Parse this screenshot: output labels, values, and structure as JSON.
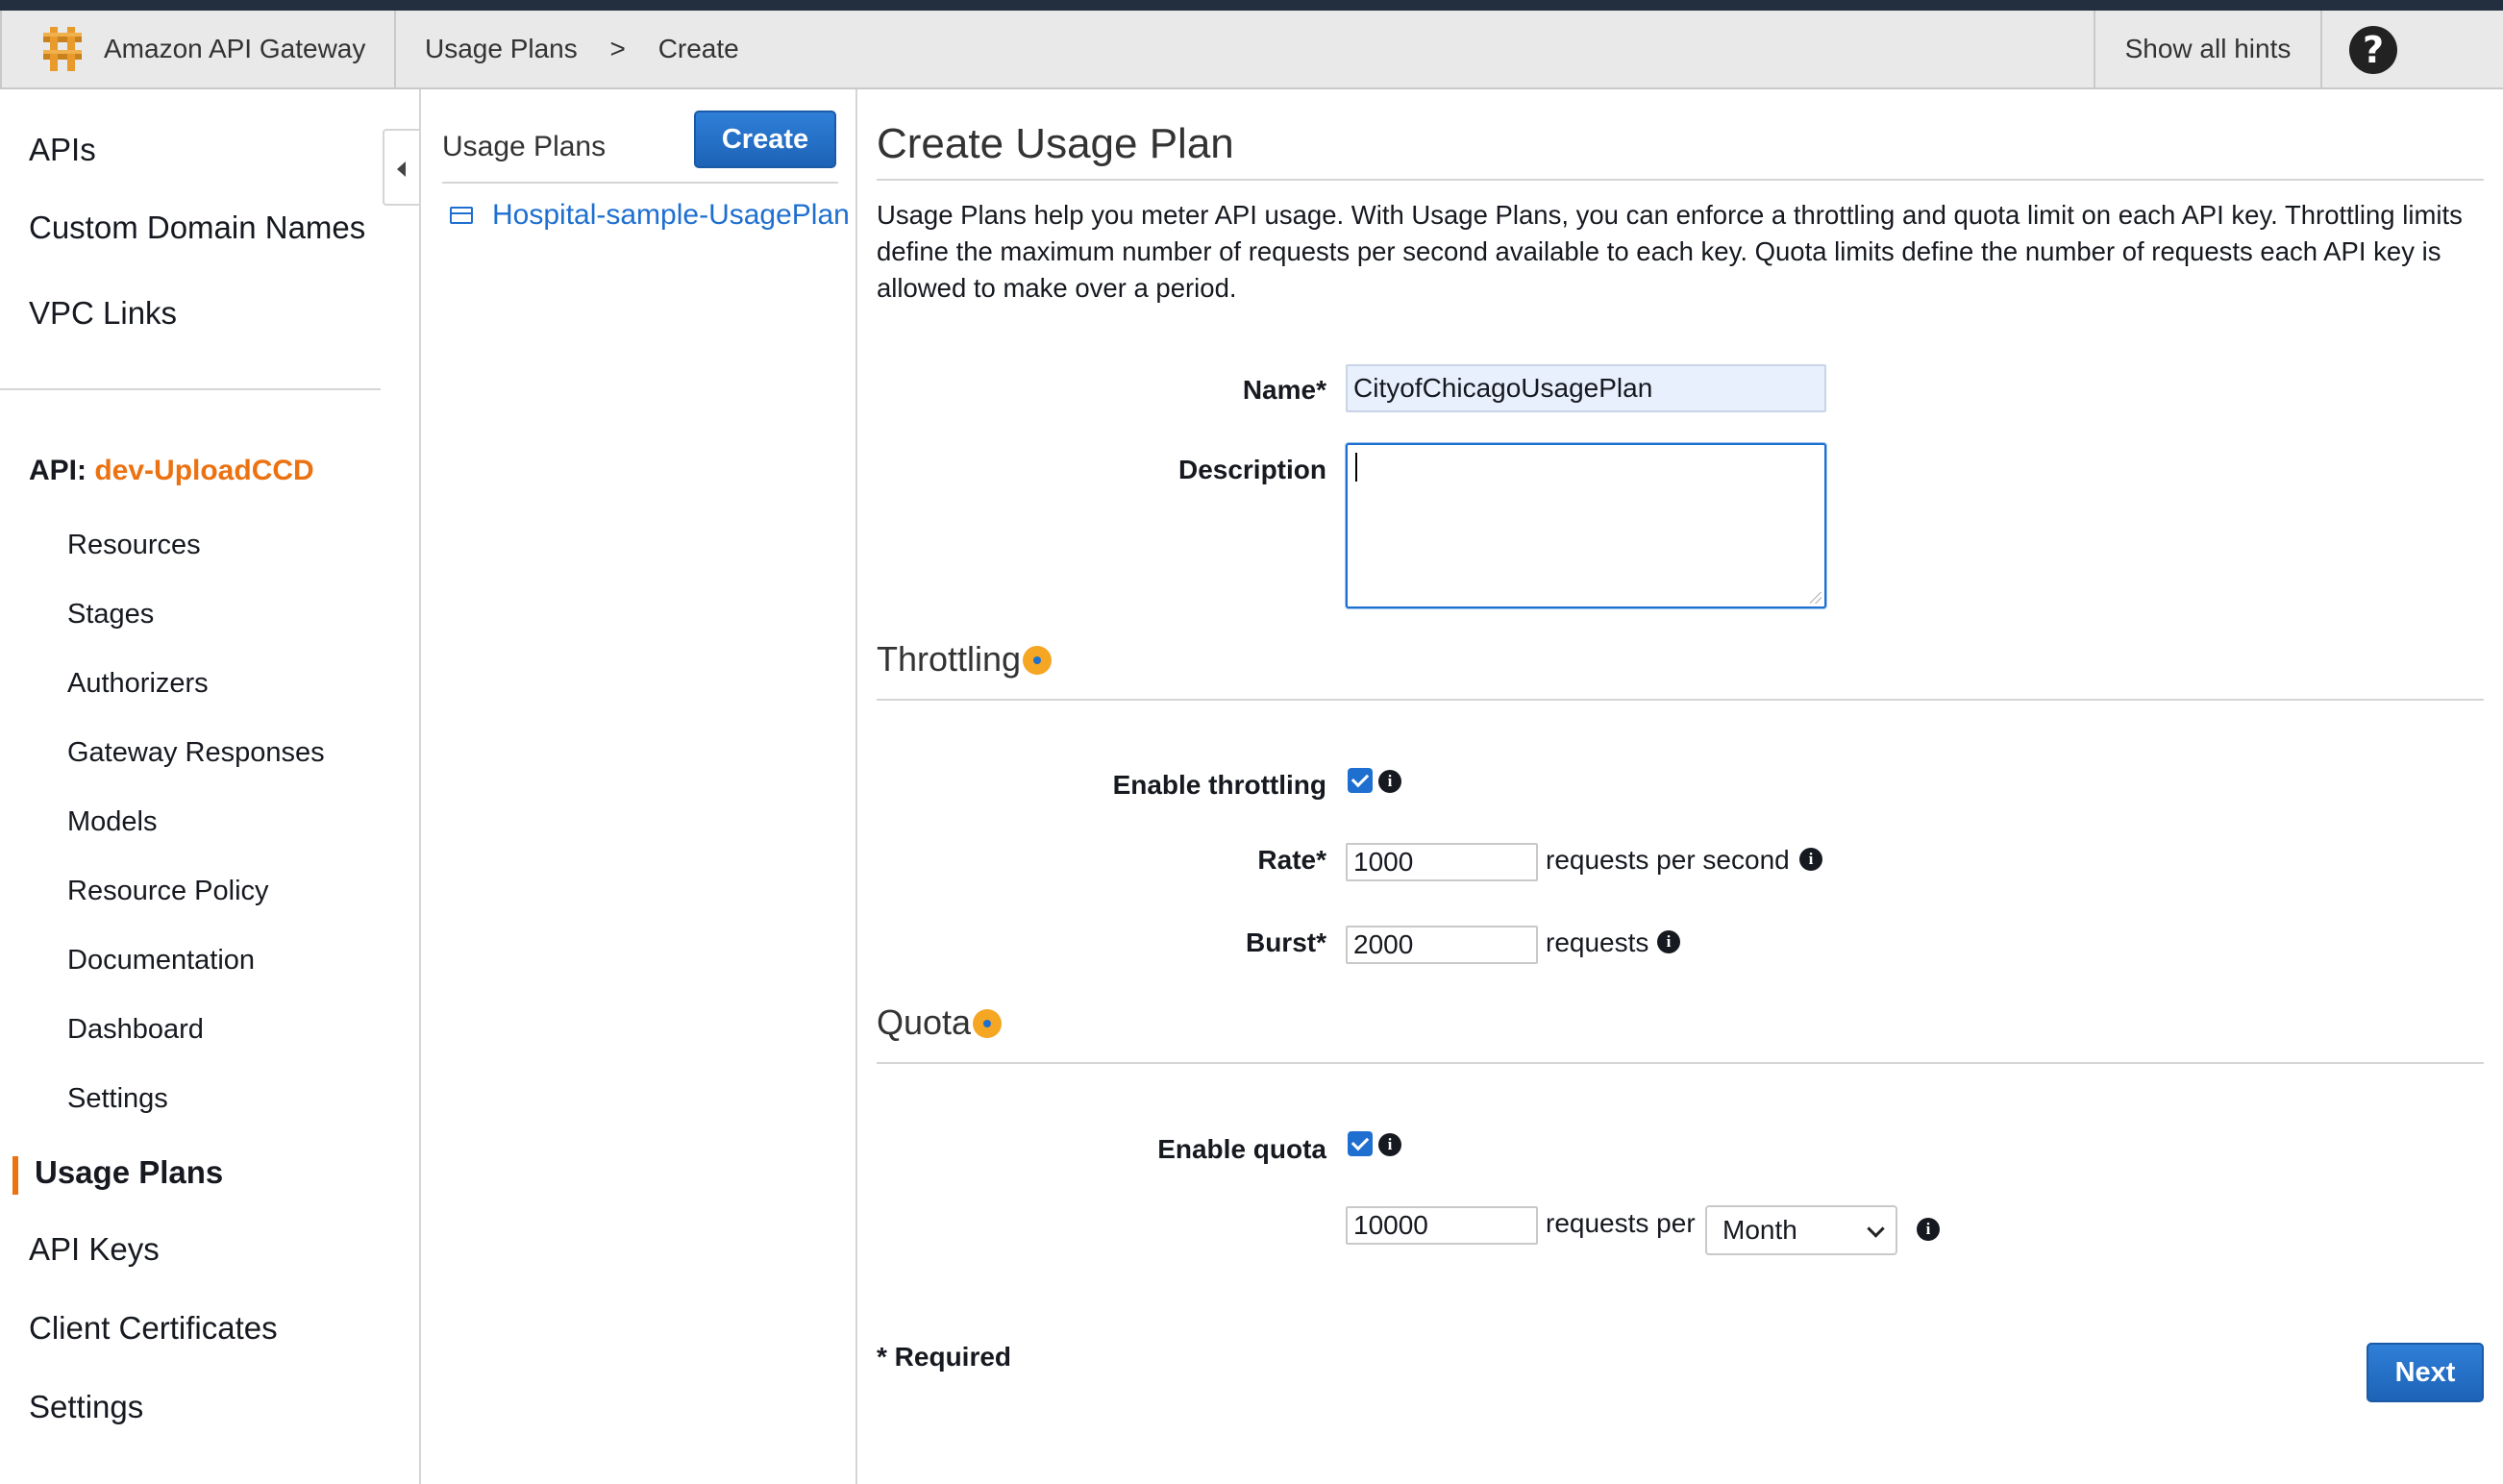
{
  "topbar": {
    "brand": "Amazon API Gateway",
    "breadcrumbs": [
      "Usage Plans",
      ">",
      "Create"
    ],
    "hints_label": "Show all hints",
    "help_label": "?"
  },
  "sidebar": {
    "top_items": [
      "APIs",
      "Custom Domain Names",
      "VPC Links"
    ],
    "api_prefix": "API:",
    "api_name": "dev-UploadCCD",
    "api_items": [
      "Resources",
      "Stages",
      "Authorizers",
      "Gateway Responses",
      "Models",
      "Resource Policy",
      "Documentation",
      "Dashboard",
      "Settings"
    ],
    "bottom_items": [
      "Usage Plans",
      "API Keys",
      "Client Certificates",
      "Settings"
    ],
    "active_item": "Usage Plans"
  },
  "middle": {
    "title": "Usage Plans",
    "create_label": "Create",
    "plans": [
      "Hospital-sample-UsagePlan"
    ]
  },
  "main": {
    "title": "Create Usage Plan",
    "intro": "Usage Plans help you meter API usage. With Usage Plans, you can enforce a throttling and quota limit on each API key. Throttling limits define the maximum number of requests per second available to each key. Quota limits define the number of requests each API key is allowed to make over a period.",
    "name_label": "Name*",
    "name_value": "CityofChicagoUsagePlan",
    "description_label": "Description",
    "description_value": "",
    "throttling": {
      "title": "Throttling",
      "enable_label": "Enable throttling",
      "enabled": true,
      "rate_label": "Rate*",
      "rate_value": "1000",
      "rate_unit": "requests per second",
      "burst_label": "Burst*",
      "burst_value": "2000",
      "burst_unit": "requests"
    },
    "quota": {
      "title": "Quota",
      "enable_label": "Enable quota",
      "enabled": true,
      "value": "10000",
      "unit": "requests per",
      "period": "Month"
    },
    "required_note": "* Required",
    "next_label": "Next"
  },
  "colors": {
    "accent": "#1e6fd0",
    "brand_orange": "#ec7211",
    "header_bg": "#232f3e"
  },
  "icons": [
    "amazon-api-gateway-logo",
    "help-icon",
    "collapse-arrow-icon",
    "usage-plan-icon",
    "info-icon",
    "hint-dot-icon"
  ]
}
